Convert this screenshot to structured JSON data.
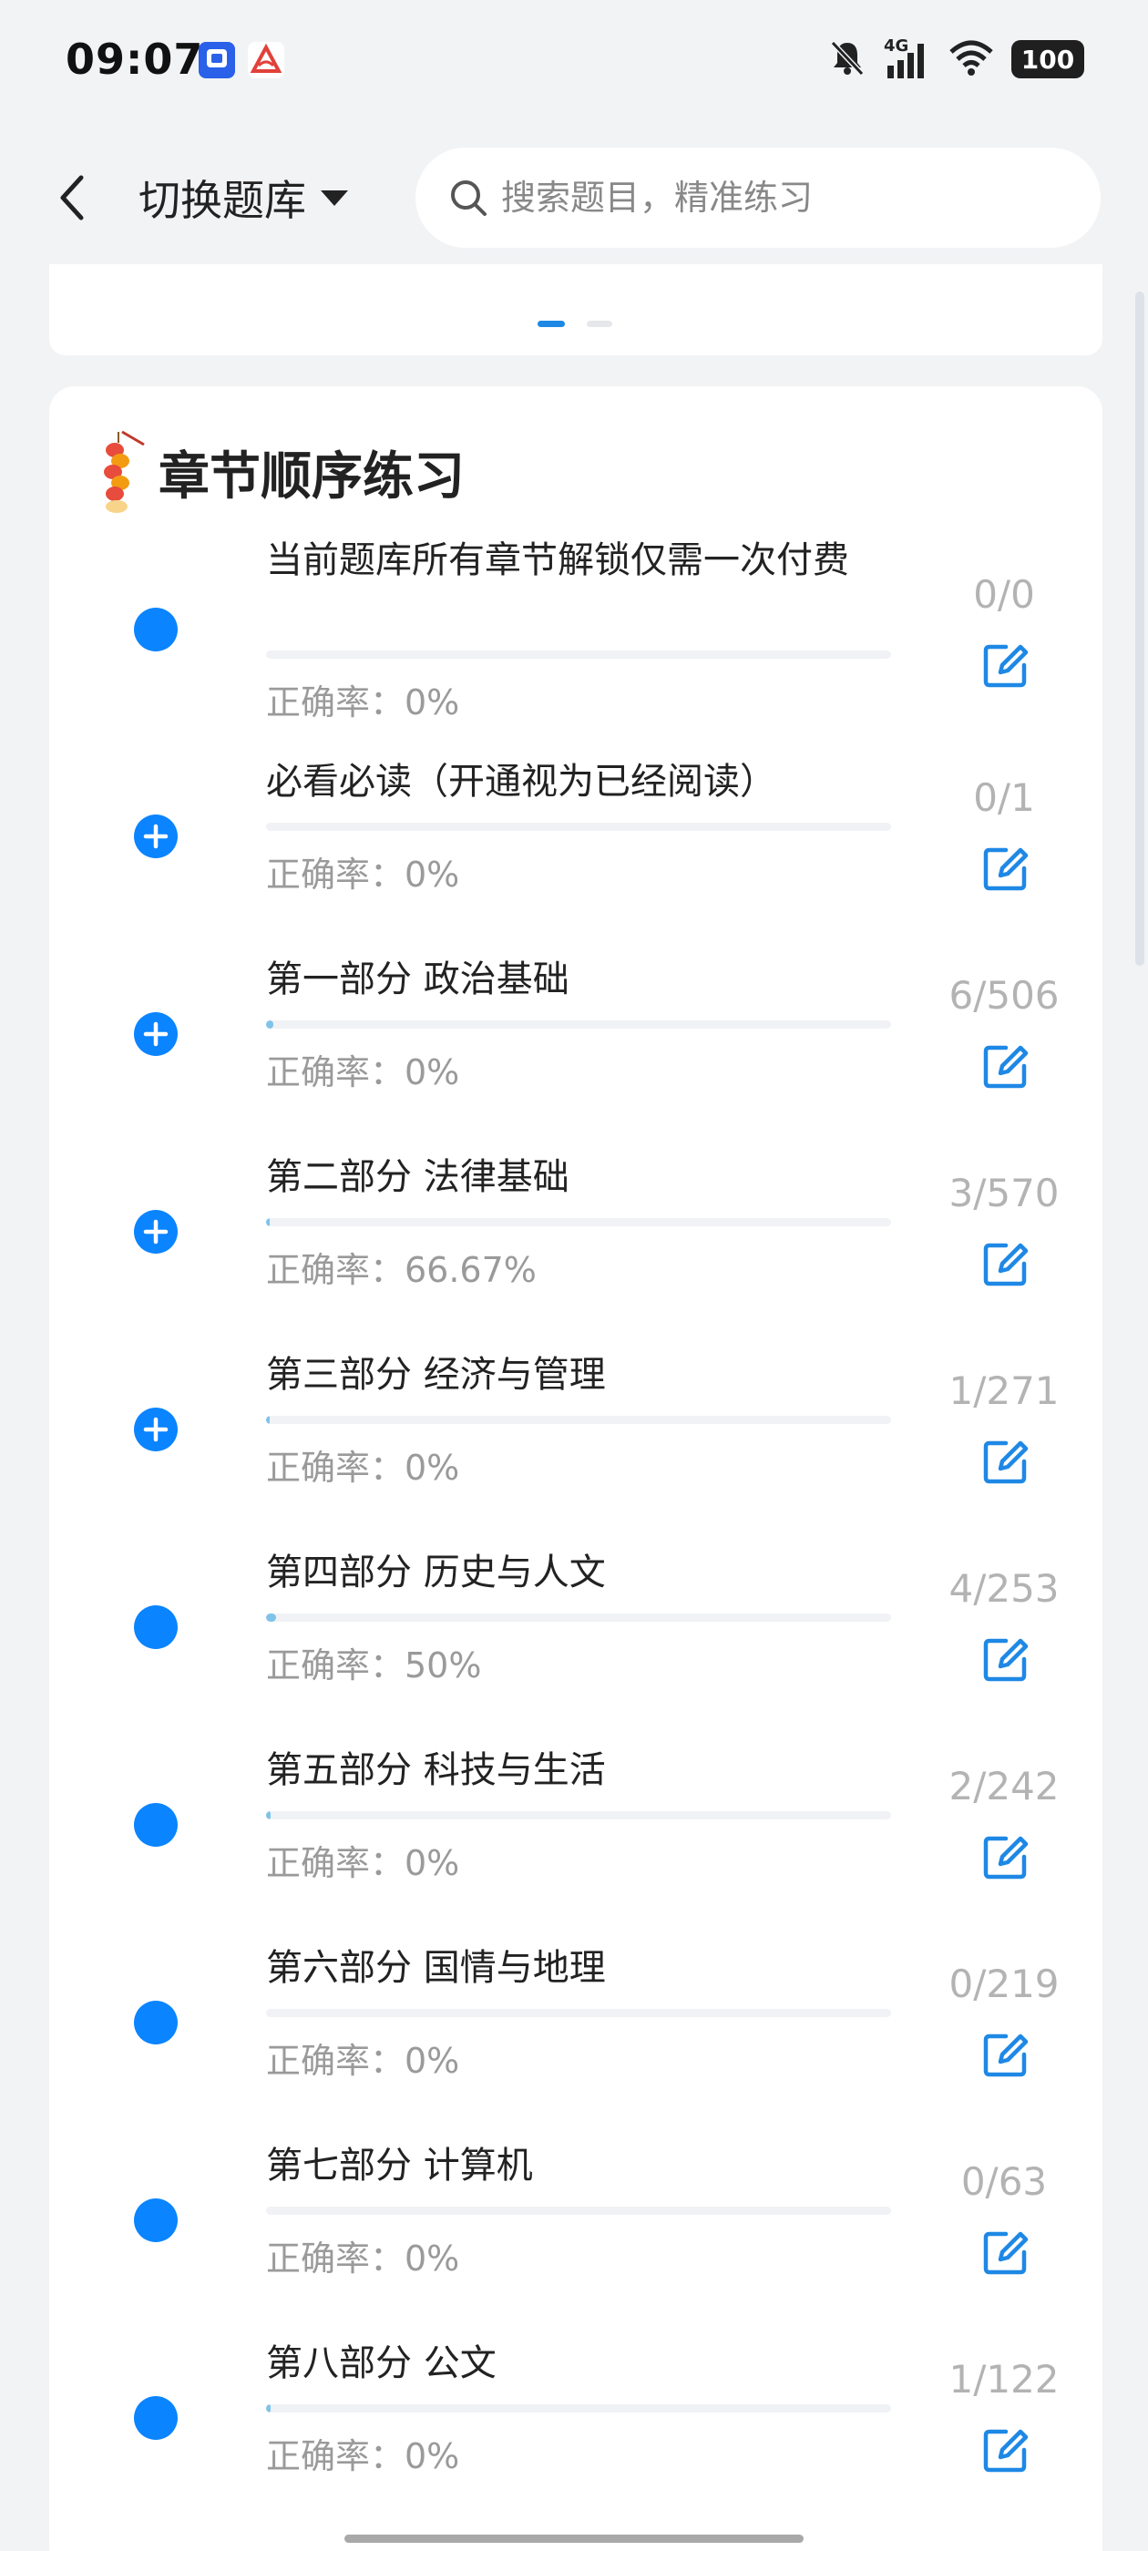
{
  "status_bar": {
    "time": "09:07",
    "network": "4G",
    "battery": "100"
  },
  "header": {
    "switch_label": "切换题库",
    "search_placeholder": "搜索题目，精准练习"
  },
  "section": {
    "title": "章节顺序练习"
  },
  "colors": {
    "accent": "#1e88e5",
    "icon_blue": "#0a84ff",
    "progress": "#7fc3ea"
  },
  "chapters": [
    {
      "title": "当前题库所有章节解锁仅需一次付费",
      "accuracy": "正确率：0%",
      "count": "0/0",
      "progress": 0,
      "expandable": false
    },
    {
      "title": "必看必读（开通视为已经阅读）",
      "accuracy": "正确率：0%",
      "count": "0/1",
      "progress": 0,
      "expandable": true
    },
    {
      "title": "第一部分 政治基础",
      "accuracy": "正确率：0%",
      "count": "6/506",
      "progress": 0.012,
      "expandable": true
    },
    {
      "title": "第二部分 法律基础",
      "accuracy": "正确率：66.67%",
      "count": "3/570",
      "progress": 0.005,
      "expandable": true
    },
    {
      "title": "第三部分 经济与管理",
      "accuracy": "正确率：0%",
      "count": "1/271",
      "progress": 0.004,
      "expandable": true
    },
    {
      "title": "第四部分 历史与人文",
      "accuracy": "正确率：50%",
      "count": "4/253",
      "progress": 0.016,
      "expandable": false
    },
    {
      "title": "第五部分 科技与生活",
      "accuracy": "正确率：0%",
      "count": "2/242",
      "progress": 0.008,
      "expandable": false
    },
    {
      "title": "第六部分 国情与地理",
      "accuracy": "正确率：0%",
      "count": "0/219",
      "progress": 0,
      "expandable": false
    },
    {
      "title": "第七部分 计算机",
      "accuracy": "正确率：0%",
      "count": "0/63",
      "progress": 0,
      "expandable": false
    },
    {
      "title": "第八部分 公文",
      "accuracy": "正确率：0%",
      "count": "1/122",
      "progress": 0.008,
      "expandable": false
    }
  ]
}
